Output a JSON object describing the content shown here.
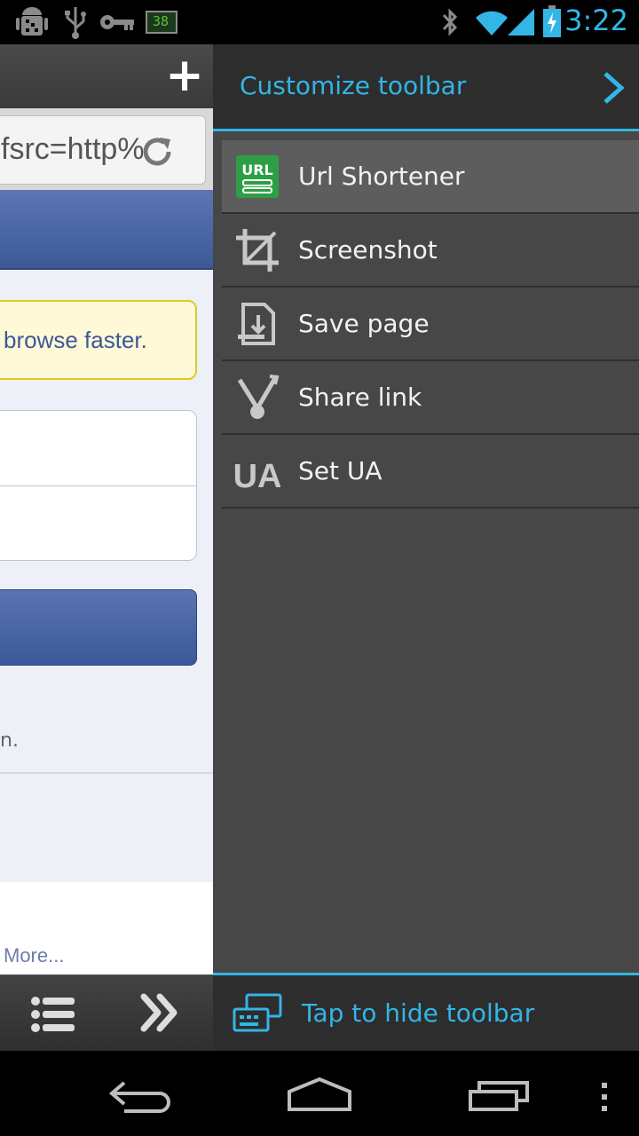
{
  "status_bar": {
    "time": "3:22",
    "battery_level_text": "38",
    "icons": [
      "android-debug-icon",
      "usb-icon",
      "key-icon",
      "battery-widget-icon",
      "bluetooth-icon",
      "wifi-icon",
      "signal-icon",
      "battery-charging-icon"
    ]
  },
  "browser": {
    "url_text": "fsrc=http%",
    "notice_text": "browse faster.",
    "footnote_text": "n.",
    "more_link": "More..."
  },
  "panel": {
    "title": "Customize toolbar",
    "items": [
      {
        "label": "Url Shortener",
        "icon": "url-shortener-icon",
        "selected": true
      },
      {
        "label": "Screenshot",
        "icon": "crop-icon",
        "selected": false
      },
      {
        "label": "Save page",
        "icon": "save-page-icon",
        "selected": false
      },
      {
        "label": "Share link",
        "icon": "share-link-icon",
        "selected": false
      },
      {
        "label": "Set UA",
        "icon": "set-ua-icon",
        "selected": false
      }
    ],
    "footer_label": "Tap to hide toolbar",
    "url_icon_text": "URL",
    "ua_icon_text": "UA"
  },
  "colors": {
    "accent": "#33b5e5",
    "panel_bg": "#474747",
    "facebook_blue": "#3b5998"
  }
}
